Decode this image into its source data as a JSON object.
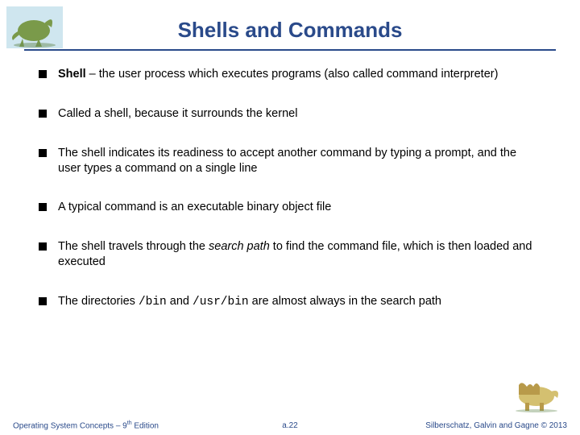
{
  "title": "Shells and Commands",
  "bullets": [
    {
      "html": "<b>Shell</b> – the user process which executes programs (also called command interpreter)"
    },
    {
      "html": "Called a shell, because it surrounds the kernel"
    },
    {
      "html": "The shell indicates its readiness to accept another command by typing a prompt, and the user types a command on a single line"
    },
    {
      "html": "A typical command is an executable binary object file"
    },
    {
      "html": "The shell travels through the <i>search path</i> to find the command file, which is then loaded and executed"
    },
    {
      "html": "The directories <code>/bin</code> and <code>/usr/bin</code> are almost always in the search path"
    }
  ],
  "footer": {
    "left_prefix": "Operating System Concepts – 9",
    "left_suffix": " Edition",
    "left_sup": "th",
    "center": "a.22",
    "right": "Silberschatz, Galvin and Gagne © 2013"
  }
}
